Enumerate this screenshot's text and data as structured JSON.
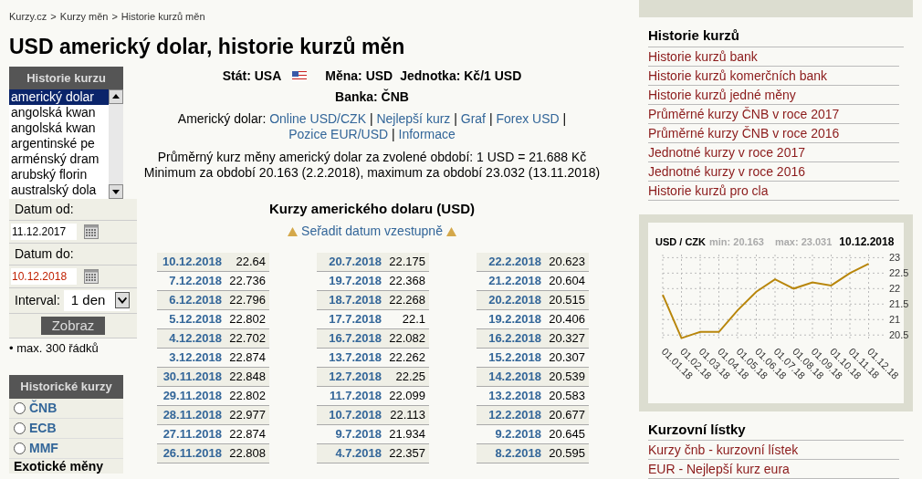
{
  "breadcrumb": [
    "Kurzy.cz",
    "Kurzy měn",
    "Historie kurzů měn"
  ],
  "breadcrumb_separator": ">",
  "title": "USD americký dolar, historie kurzů měn",
  "currency_list": {
    "header": "Historie kurzu",
    "items": [
      {
        "label": "americký dolar",
        "selected": true
      },
      {
        "label": "angolská kwan",
        "selected": false
      },
      {
        "label": "angolská kwan",
        "selected": false
      },
      {
        "label": "argentinské pe",
        "selected": false
      },
      {
        "label": "arménský dram",
        "selected": false
      },
      {
        "label": "arubský florin",
        "selected": false
      },
      {
        "label": "australský dola",
        "selected": false
      }
    ]
  },
  "form": {
    "from_label": "Datum od:",
    "from_value": "11.12.2017",
    "to_label": "Datum do:",
    "to_value": "10.12.2018",
    "interval_label": "Interval:",
    "interval_value": "1 den",
    "submit": "Zobraz",
    "note": "• max. 300 řádků"
  },
  "historic_box": {
    "header": "Historické kurzy",
    "options": [
      {
        "label": "ČNB",
        "selected": false
      },
      {
        "label": "ECB",
        "selected": false
      },
      {
        "label": "MMF",
        "selected": false
      }
    ],
    "next_header": "Exotické měny"
  },
  "info": {
    "line1": [
      {
        "label": "Stát:",
        "value": "USA"
      },
      {
        "label": "Měna:",
        "value": "USD"
      },
      {
        "label": "Jednotka:",
        "value": "Kč/1 USD"
      }
    ],
    "bank_label": "Banka:",
    "bank_value": "ČNB",
    "links_label": "Americký dolar:",
    "links": [
      "Online USD/CZK",
      "Nejlepší kurz",
      "Graf",
      "Forex USD",
      "Pozice EUR/USD",
      "Informace"
    ],
    "link_separator": "|",
    "summary": "Průměrný kurz měny americký dolar za zvolené období: 1 USD = 21.688 Kč Minimum za období 20.163 (2.2.2018), maximum za období 23.032 (13.11.2018)"
  },
  "rates": {
    "title": "Kurzy amerického dolaru (USD)",
    "sort_link": "Seřadit datum vzestupně",
    "columns": [
      [
        {
          "date": "10.12.2018",
          "value": "22.64"
        },
        {
          "date": "7.12.2018",
          "value": "22.736"
        },
        {
          "date": "6.12.2018",
          "value": "22.796"
        },
        {
          "date": "5.12.2018",
          "value": "22.802"
        },
        {
          "date": "4.12.2018",
          "value": "22.702"
        },
        {
          "date": "3.12.2018",
          "value": "22.874"
        },
        {
          "date": "30.11.2018",
          "value": "22.848"
        },
        {
          "date": "29.11.2018",
          "value": "22.802"
        },
        {
          "date": "28.11.2018",
          "value": "22.977"
        },
        {
          "date": "27.11.2018",
          "value": "22.874"
        },
        {
          "date": "26.11.2018",
          "value": "22.808"
        }
      ],
      [
        {
          "date": "20.7.2018",
          "value": "22.175"
        },
        {
          "date": "19.7.2018",
          "value": "22.368"
        },
        {
          "date": "18.7.2018",
          "value": "22.268"
        },
        {
          "date": "17.7.2018",
          "value": "22.1"
        },
        {
          "date": "16.7.2018",
          "value": "22.082"
        },
        {
          "date": "13.7.2018",
          "value": "22.262"
        },
        {
          "date": "12.7.2018",
          "value": "22.25"
        },
        {
          "date": "11.7.2018",
          "value": "22.099"
        },
        {
          "date": "10.7.2018",
          "value": "22.113"
        },
        {
          "date": "9.7.2018",
          "value": "21.934"
        },
        {
          "date": "4.7.2018",
          "value": "22.357"
        }
      ],
      [
        {
          "date": "22.2.2018",
          "value": "20.623"
        },
        {
          "date": "21.2.2018",
          "value": "20.604"
        },
        {
          "date": "20.2.2018",
          "value": "20.515"
        },
        {
          "date": "19.2.2018",
          "value": "20.406"
        },
        {
          "date": "16.2.2018",
          "value": "20.327"
        },
        {
          "date": "15.2.2018",
          "value": "20.307"
        },
        {
          "date": "14.2.2018",
          "value": "20.539"
        },
        {
          "date": "13.2.2018",
          "value": "20.583"
        },
        {
          "date": "12.2.2018",
          "value": "20.677"
        },
        {
          "date": "9.2.2018",
          "value": "20.645"
        },
        {
          "date": "8.2.2018",
          "value": "20.595"
        }
      ]
    ]
  },
  "sidebar_history": {
    "title": "Historie kurzů",
    "links": [
      "Historie kurzů bank",
      "Historie kurzů komerčních bank",
      "Historie kurzů jedné měny",
      "Průměrné kurzy ČNB v roce 2017",
      "Průměrné kurzy ČNB v roce 2016",
      "Jednotné kurzy v roce 2017",
      "Jednotné kurzy v roce 2016",
      "Historie kurzů pro cla"
    ]
  },
  "chart": {
    "pair": "USD / CZK",
    "min": "min: 20.163",
    "max": "max: 23.031",
    "date": "10.12.2018",
    "chart_data": {
      "type": "line",
      "x": [
        "01.01.18",
        "01.02.18",
        "01.03.18",
        "01.04.18",
        "01.05.18",
        "01.06.18",
        "01.07.18",
        "01.08.18",
        "01.09.18",
        "01.10.18",
        "01.11.18",
        "01.12.18"
      ],
      "series": [
        {
          "color": "#b8860b",
          "values": [
            21.8,
            20.4,
            20.6,
            20.6,
            21.3,
            21.9,
            22.3,
            22.0,
            22.2,
            22.1,
            22.5,
            22.8
          ]
        }
      ],
      "yticks": [
        20.5,
        21,
        21.5,
        22,
        22.5,
        23
      ],
      "ylim": [
        20.3,
        23.1
      ],
      "grid": true
    }
  },
  "sidebar_lists": {
    "title": "Kurzovní lístky",
    "links": [
      "Kurzy čnb - kurzovní lístek",
      "EUR - Nejlepší kurz eura"
    ]
  }
}
